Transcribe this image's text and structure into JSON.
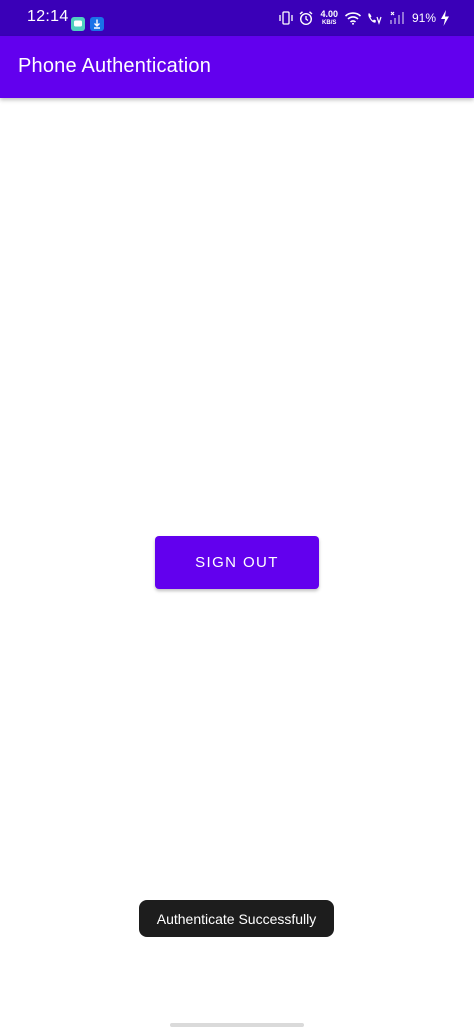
{
  "status_bar": {
    "time": "12:14",
    "network_speed_value": "4.00",
    "network_speed_unit": "KB/S",
    "battery_percent": "91%",
    "background_color": "#3a00b8",
    "notification_icons": [
      "chat-notification-icon",
      "download-notification-icon"
    ],
    "status_icons": [
      "vibrate-icon",
      "alarm-icon",
      "wifi-icon",
      "volte-call-icon",
      "signal-icon",
      "battery-charging-icon"
    ]
  },
  "app_bar": {
    "title": "Phone Authentication",
    "background_color": "#6200ee"
  },
  "main": {
    "sign_out_label": "SIGN OUT",
    "button_color": "#6200ee"
  },
  "toast": {
    "message": "Authenticate Successfully"
  }
}
